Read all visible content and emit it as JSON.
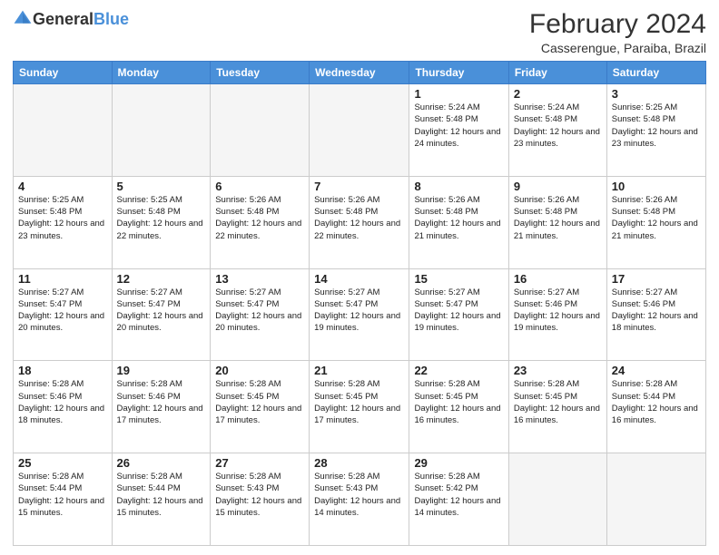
{
  "logo": {
    "text_general": "General",
    "text_blue": "Blue"
  },
  "title": "February 2024",
  "subtitle": "Casserengue, Paraiba, Brazil",
  "headers": [
    "Sunday",
    "Monday",
    "Tuesday",
    "Wednesday",
    "Thursday",
    "Friday",
    "Saturday"
  ],
  "weeks": [
    [
      {
        "day": "",
        "info": ""
      },
      {
        "day": "",
        "info": ""
      },
      {
        "day": "",
        "info": ""
      },
      {
        "day": "",
        "info": ""
      },
      {
        "day": "1",
        "info": "Sunrise: 5:24 AM\nSunset: 5:48 PM\nDaylight: 12 hours\nand 24 minutes."
      },
      {
        "day": "2",
        "info": "Sunrise: 5:24 AM\nSunset: 5:48 PM\nDaylight: 12 hours\nand 23 minutes."
      },
      {
        "day": "3",
        "info": "Sunrise: 5:25 AM\nSunset: 5:48 PM\nDaylight: 12 hours\nand 23 minutes."
      }
    ],
    [
      {
        "day": "4",
        "info": "Sunrise: 5:25 AM\nSunset: 5:48 PM\nDaylight: 12 hours\nand 23 minutes."
      },
      {
        "day": "5",
        "info": "Sunrise: 5:25 AM\nSunset: 5:48 PM\nDaylight: 12 hours\nand 22 minutes."
      },
      {
        "day": "6",
        "info": "Sunrise: 5:26 AM\nSunset: 5:48 PM\nDaylight: 12 hours\nand 22 minutes."
      },
      {
        "day": "7",
        "info": "Sunrise: 5:26 AM\nSunset: 5:48 PM\nDaylight: 12 hours\nand 22 minutes."
      },
      {
        "day": "8",
        "info": "Sunrise: 5:26 AM\nSunset: 5:48 PM\nDaylight: 12 hours\nand 21 minutes."
      },
      {
        "day": "9",
        "info": "Sunrise: 5:26 AM\nSunset: 5:48 PM\nDaylight: 12 hours\nand 21 minutes."
      },
      {
        "day": "10",
        "info": "Sunrise: 5:26 AM\nSunset: 5:48 PM\nDaylight: 12 hours\nand 21 minutes."
      }
    ],
    [
      {
        "day": "11",
        "info": "Sunrise: 5:27 AM\nSunset: 5:47 PM\nDaylight: 12 hours\nand 20 minutes."
      },
      {
        "day": "12",
        "info": "Sunrise: 5:27 AM\nSunset: 5:47 PM\nDaylight: 12 hours\nand 20 minutes."
      },
      {
        "day": "13",
        "info": "Sunrise: 5:27 AM\nSunset: 5:47 PM\nDaylight: 12 hours\nand 20 minutes."
      },
      {
        "day": "14",
        "info": "Sunrise: 5:27 AM\nSunset: 5:47 PM\nDaylight: 12 hours\nand 19 minutes."
      },
      {
        "day": "15",
        "info": "Sunrise: 5:27 AM\nSunset: 5:47 PM\nDaylight: 12 hours\nand 19 minutes."
      },
      {
        "day": "16",
        "info": "Sunrise: 5:27 AM\nSunset: 5:46 PM\nDaylight: 12 hours\nand 19 minutes."
      },
      {
        "day": "17",
        "info": "Sunrise: 5:27 AM\nSunset: 5:46 PM\nDaylight: 12 hours\nand 18 minutes."
      }
    ],
    [
      {
        "day": "18",
        "info": "Sunrise: 5:28 AM\nSunset: 5:46 PM\nDaylight: 12 hours\nand 18 minutes."
      },
      {
        "day": "19",
        "info": "Sunrise: 5:28 AM\nSunset: 5:46 PM\nDaylight: 12 hours\nand 17 minutes."
      },
      {
        "day": "20",
        "info": "Sunrise: 5:28 AM\nSunset: 5:45 PM\nDaylight: 12 hours\nand 17 minutes."
      },
      {
        "day": "21",
        "info": "Sunrise: 5:28 AM\nSunset: 5:45 PM\nDaylight: 12 hours\nand 17 minutes."
      },
      {
        "day": "22",
        "info": "Sunrise: 5:28 AM\nSunset: 5:45 PM\nDaylight: 12 hours\nand 16 minutes."
      },
      {
        "day": "23",
        "info": "Sunrise: 5:28 AM\nSunset: 5:45 PM\nDaylight: 12 hours\nand 16 minutes."
      },
      {
        "day": "24",
        "info": "Sunrise: 5:28 AM\nSunset: 5:44 PM\nDaylight: 12 hours\nand 16 minutes."
      }
    ],
    [
      {
        "day": "25",
        "info": "Sunrise: 5:28 AM\nSunset: 5:44 PM\nDaylight: 12 hours\nand 15 minutes."
      },
      {
        "day": "26",
        "info": "Sunrise: 5:28 AM\nSunset: 5:44 PM\nDaylight: 12 hours\nand 15 minutes."
      },
      {
        "day": "27",
        "info": "Sunrise: 5:28 AM\nSunset: 5:43 PM\nDaylight: 12 hours\nand 15 minutes."
      },
      {
        "day": "28",
        "info": "Sunrise: 5:28 AM\nSunset: 5:43 PM\nDaylight: 12 hours\nand 14 minutes."
      },
      {
        "day": "29",
        "info": "Sunrise: 5:28 AM\nSunset: 5:42 PM\nDaylight: 12 hours\nand 14 minutes."
      },
      {
        "day": "",
        "info": ""
      },
      {
        "day": "",
        "info": ""
      }
    ]
  ]
}
